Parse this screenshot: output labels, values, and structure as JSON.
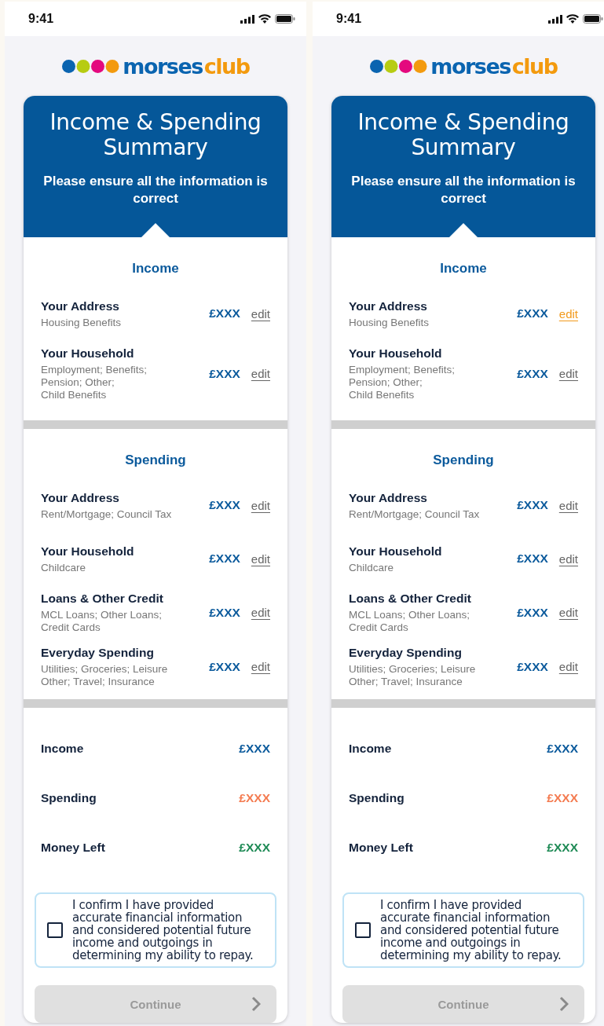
{
  "screens": [
    {
      "status_bar": {
        "time": "9:41"
      },
      "logo": {
        "text_1": "morses",
        "text_2": "club"
      },
      "header": {
        "title": "Income & Spending Summary",
        "subtitle": "Please ensure all the information is correct"
      },
      "sections": [
        {
          "title": "Income",
          "rows": [
            {
              "label": "Your Address",
              "detail": "Housing Benefits",
              "amount": "£XXX",
              "action": "edit",
              "highlighted": false
            },
            {
              "label": "Your Household",
              "detail": "Employment; Benefits;\nPension; Other;\nChild Benefits",
              "amount": "£XXX",
              "action": "edit",
              "highlighted": false
            }
          ]
        },
        {
          "title": "Spending",
          "rows": [
            {
              "label": "Your Address",
              "detail": "Rent/Mortgage; Council Tax",
              "amount": "£XXX",
              "action": "edit",
              "highlighted": false
            },
            {
              "label": "Your Household",
              "detail": "Childcare",
              "amount": "£XXX",
              "action": "edit",
              "highlighted": false
            },
            {
              "label": "Loans & Other Credit",
              "detail": "MCL Loans; Other Loans;\nCredit Cards",
              "amount": "£XXX",
              "action": "edit",
              "highlighted": false
            },
            {
              "label": "Everyday Spending",
              "detail": "Utilities; Groceries; Leisure\nOther; Travel; Insurance",
              "amount": "£XXX",
              "action": "edit",
              "highlighted": false
            }
          ]
        }
      ],
      "totals": [
        {
          "label": "Income",
          "amount": "£XXX",
          "color": "#0b5a9c"
        },
        {
          "label": "Spending",
          "amount": "£XXX",
          "color": "#f47b50"
        },
        {
          "label": "Money Left",
          "amount": "£XXX",
          "color": "#1e8a55"
        }
      ],
      "confirmation": {
        "text": "I confirm I have provided accurate financial information and considered potential future income and outgoings in determining my ability to repay.",
        "checked": false
      },
      "continue_button": {
        "label": "Continue",
        "disabled": true
      }
    },
    {
      "status_bar": {
        "time": "9:41"
      },
      "logo": {
        "text_1": "morses",
        "text_2": "club"
      },
      "header": {
        "title": "Income & Spending Summary",
        "subtitle": "Please ensure all the information is correct"
      },
      "sections": [
        {
          "title": "Income",
          "rows": [
            {
              "label": "Your Address",
              "detail": "Housing Benefits",
              "amount": "£XXX",
              "action": "edit",
              "highlighted": true
            },
            {
              "label": "Your Household",
              "detail": "Employment; Benefits;\nPension; Other;\nChild Benefits",
              "amount": "£XXX",
              "action": "edit",
              "highlighted": false
            }
          ]
        },
        {
          "title": "Spending",
          "rows": [
            {
              "label": "Your Address",
              "detail": "Rent/Mortgage; Council Tax",
              "amount": "£XXX",
              "action": "edit",
              "highlighted": false
            },
            {
              "label": "Your Household",
              "detail": "Childcare",
              "amount": "£XXX",
              "action": "edit",
              "highlighted": false
            },
            {
              "label": "Loans & Other Credit",
              "detail": "MCL Loans; Other Loans;\nCredit Cards",
              "amount": "£XXX",
              "action": "edit",
              "highlighted": false
            },
            {
              "label": "Everyday Spending",
              "detail": "Utilities; Groceries; Leisure\nOther; Travel; Insurance",
              "amount": "£XXX",
              "action": "edit",
              "highlighted": false
            }
          ]
        }
      ],
      "totals": [
        {
          "label": "Income",
          "amount": "£XXX",
          "color": "#0b5a9c"
        },
        {
          "label": "Spending",
          "amount": "£XXX",
          "color": "#f47b50"
        },
        {
          "label": "Money Left",
          "amount": "£XXX",
          "color": "#1e8a55"
        }
      ],
      "confirmation": {
        "text": "I confirm I have provided accurate financial information and considered potential future income and outgoings in determining my ability to repay.",
        "checked": false
      },
      "continue_button": {
        "label": "Continue",
        "disabled": true
      }
    }
  ]
}
